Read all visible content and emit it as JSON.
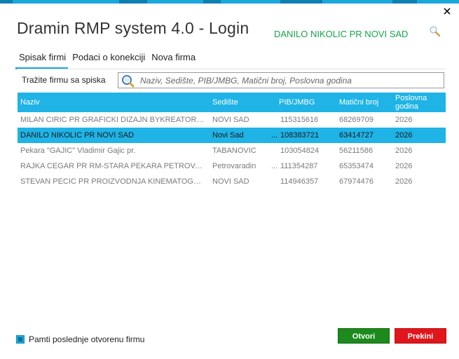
{
  "window": {
    "title": "Dramin RMP system 4.0 - Login",
    "company": "DANILO NIKOLIC PR NOVI SAD",
    "accent": "#1aa7dc"
  },
  "tabs": [
    {
      "label": "Spisak firmi",
      "active": true
    },
    {
      "label": "Podaci o konekciji",
      "active": false
    },
    {
      "label": "Nova firma",
      "active": false
    }
  ],
  "search": {
    "label": "Tražite firmu sa spiska",
    "placeholder": "Naziv, Sedište, PIB/JMBG, Matični broj, Poslovna godina",
    "value": ""
  },
  "table": {
    "columns": [
      "Naziv",
      "Sedište",
      "PIB/JMBG",
      "Matični broj",
      "Poslovna godina"
    ],
    "rows": [
      {
        "naziv": "MILAN CIRIC PR GRAFICKI DIZAJN BYKREATOR STU...",
        "sediste": "NOVI SAD",
        "pib_prefix": "",
        "pib": "115315616",
        "maticni": "68269709",
        "godina": "2026",
        "selected": false
      },
      {
        "naziv": "DANILO NIKOLIC PR NOVI SAD",
        "sediste": "Novi Sad",
        "pib_prefix": "...",
        "pib": "108383721",
        "maticni": "63414727",
        "godina": "2026",
        "selected": true
      },
      {
        "naziv": "Pekara \"GAJIC\" Vladimir Gajic pr.",
        "sediste": "TABANOVIC",
        "pib_prefix": "",
        "pib": "103054824",
        "maticni": "56211586",
        "godina": "2026",
        "selected": false
      },
      {
        "naziv": "RAJKA CEGAR PR RM-STARA PEKARA PETROVARAD...",
        "sediste": "Petrovaradin",
        "pib_prefix": "...",
        "pib": "111354287",
        "maticni": "65353474",
        "godina": "2026",
        "selected": false
      },
      {
        "naziv": "STEVAN PECIC PR PROIZVODNJA KINEMATOGRAFS...",
        "sediste": "NOVI SAD",
        "pib_prefix": "",
        "pib": "114946357",
        "maticni": "67974476",
        "godina": "2026",
        "selected": false
      }
    ]
  },
  "footer": {
    "remember_label": "Pamti poslednje otvorenu firmu",
    "remember_checked": true,
    "ok_label": "Otvori",
    "cancel_label": "Prekini",
    "ok_color": "#1d8a1d",
    "cancel_color": "#e0161c"
  },
  "icons": {
    "close": "close-icon",
    "magnifier": "magnifier-icon",
    "search": "search-icon"
  }
}
